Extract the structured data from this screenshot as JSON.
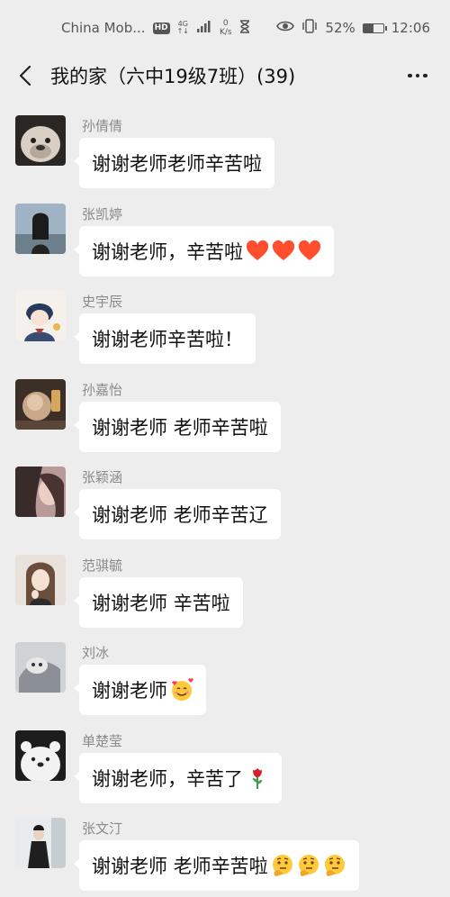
{
  "status_bar": {
    "carrier": "China Mob...",
    "network_hd": "HD",
    "network_type": "4G",
    "speed_value": "0",
    "speed_unit": "K/s",
    "battery": "52%",
    "time": "12:06"
  },
  "header": {
    "title": "我的家（六中19级7班）(39)"
  },
  "messages": [
    {
      "sender": "孙倩倩",
      "text": "谢谢老师老师辛苦啦",
      "emojis": []
    },
    {
      "sender": "张凯婷",
      "text": "谢谢老师，辛苦啦",
      "emojis": [
        "heart-icon",
        "heart-icon",
        "heart-icon"
      ]
    },
    {
      "sender": "史宇辰",
      "text": "谢谢老师辛苦啦！",
      "emojis": []
    },
    {
      "sender": "孙嘉怡",
      "text": "谢谢老师 老师辛苦啦",
      "emojis": []
    },
    {
      "sender": "张颖涵",
      "text": "谢谢老师 老师辛苦辽",
      "emojis": []
    },
    {
      "sender": "范骐毓",
      "text": "谢谢老师 辛苦啦",
      "emojis": []
    },
    {
      "sender": "刘冰",
      "text": "谢谢老师",
      "emojis": [
        "smiling-face-with-hearts-icon"
      ]
    },
    {
      "sender": "单楚莹",
      "text": "谢谢老师，辛苦了",
      "emojis": [
        "rose-icon"
      ]
    },
    {
      "sender": "张文汀",
      "text": "谢谢老师 老师辛苦啦",
      "emojis": [
        "thinking-face-icon",
        "thinking-face-icon",
        "thinking-face-icon"
      ]
    }
  ],
  "colors": {
    "background": "#ededed",
    "bubble": "#ffffff",
    "sender_name": "#8a8a8a",
    "heart": "#ff4d2e"
  }
}
